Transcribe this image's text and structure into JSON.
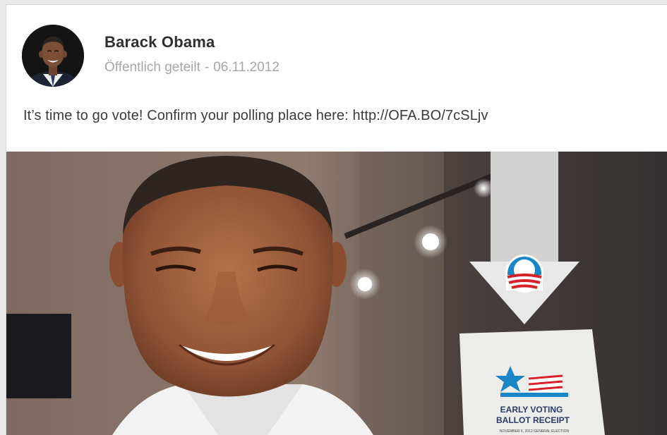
{
  "post": {
    "author": "Barack Obama",
    "visibility": "Öffentlich geteilt",
    "separator": "-",
    "date": "06.11.2012",
    "text": "It’s time to go vote! Confirm your polling place here:",
    "link": "http://OFA.BO/7cSLjv"
  },
  "image": {
    "receipt_line1": "EARLY VOTING",
    "receipt_line2": "BALLOT RECEIPT",
    "receipt_small": "NOVEMBER 6, 2012 GENERAL ELECTION"
  },
  "colors": {
    "author": "#2f2f2f",
    "meta": "#a6a6a6",
    "logo_blue": "#1b86c6",
    "logo_red": "#d6202a"
  }
}
